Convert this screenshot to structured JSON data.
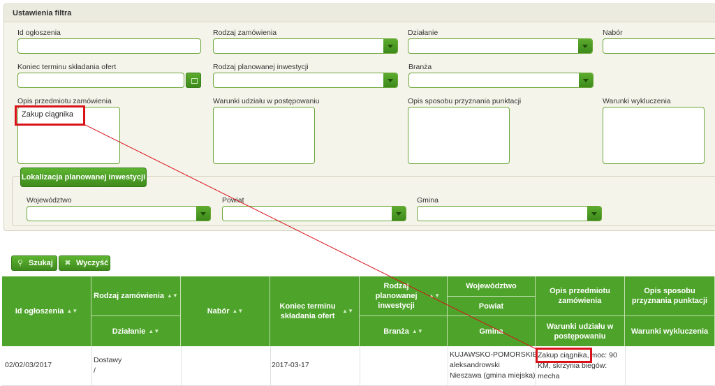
{
  "panel": {
    "title": "Ustawienia filtra"
  },
  "fields": {
    "id_label": "Id ogłoszenia",
    "rodzaj_zam_label": "Rodzaj zamówienia",
    "dzialanie_label": "Działanie",
    "nabor_label": "Nabór",
    "koniec_label": "Koniec terminu składania ofert",
    "rodzaj_inw_label": "Rodzaj planowanej inwestycji",
    "branza_label": "Branża",
    "opis_label": "Opis przedmiotu zamówienia",
    "opis_value": "Zakup ciągnika",
    "warunki_label": "Warunki udziału w postępowaniu",
    "punktacja_label": "Opis sposobu przyznania punktacji",
    "wykluczenia_label": "Warunki wykluczenia"
  },
  "location": {
    "button": "Lokalizacja planowanej inwestycji",
    "wojewodztwo_label": "Województwo",
    "powiat_label": "Powiat",
    "gmina_label": "Gmina"
  },
  "actions": {
    "search": "Szukaj",
    "clear": "Wyczyść"
  },
  "grid": {
    "headers": {
      "id": "Id ogłoszenia",
      "rodzaj_zam": "Rodzaj zamówienia",
      "dzialanie": "Działanie",
      "nabor": "Nabór",
      "koniec": "Koniec terminu składania ofert",
      "rodzaj_inw": "Rodzaj planowanej inwestycji",
      "branza": "Branża",
      "wojewodztwo": "Województwo",
      "powiat": "Powiat",
      "gmina": "Gmina",
      "opis": "Opis przedmiotu zamówienia",
      "warunki": "Warunki udziału w postępowaniu",
      "punktacja": "Opis sposobu przyznania punktacji",
      "wykluczenia": "Warunki wykluczenia"
    },
    "row": {
      "id": "02/02/03/2017",
      "rodzaj_zam": "Dostawy",
      "dzialanie": "/",
      "koniec": "2017-03-17",
      "wojewodztwo": "KUJAWSKO-POMORSKIE",
      "powiat": "aleksandrowski",
      "gmina": "Nieszawa (gmina miejska)",
      "opis_hl": "Zakup ciągnika,",
      "opis_rest1": " moc: 90",
      "opis_rest2": "KM, skrzynia biegów:",
      "opis_rest3": "mecha"
    }
  },
  "colors": {
    "accent": "#4ea32a",
    "highlight": "#d9121a"
  }
}
